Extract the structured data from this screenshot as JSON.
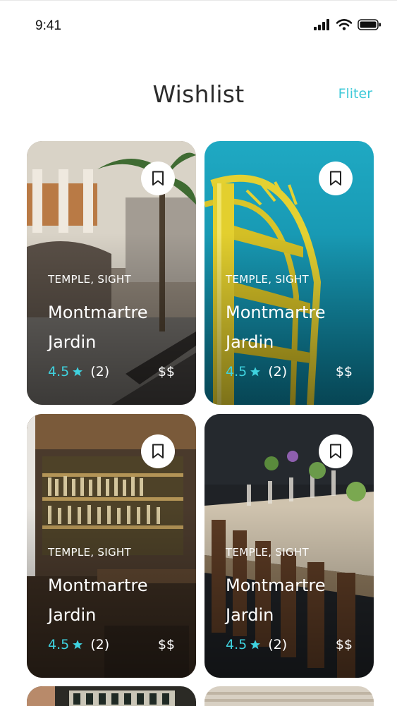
{
  "status_bar": {
    "time": "9:41",
    "icons": [
      "signal-icon",
      "wifi-icon",
      "battery-icon"
    ]
  },
  "header": {
    "title": "Wishlist",
    "filter_label": "Fliter"
  },
  "accent_color": "#3dc9d8",
  "cards": [
    {
      "tags": "TEMPLE, SIGHT",
      "name": "Montmartre Jardin",
      "rating": "4.5",
      "reviews": "(2)",
      "price": "$$",
      "photo": "courtyard-with-palm-tree"
    },
    {
      "tags": "TEMPLE, SIGHT",
      "name": "Montmartre Jardin",
      "rating": "4.5",
      "reviews": "(2)",
      "price": "$$",
      "photo": "yellow-spiral-staircase"
    },
    {
      "tags": "TEMPLE, SIGHT",
      "name": "Montmartre Jardin",
      "rating": "4.5",
      "reviews": "(2)",
      "price": "$$",
      "photo": "bar-interior"
    },
    {
      "tags": "TEMPLE, SIGHT",
      "name": "Montmartre Jardin",
      "rating": "4.5",
      "reviews": "(2)",
      "price": "$$",
      "photo": "restaurant-dining-table"
    }
  ]
}
